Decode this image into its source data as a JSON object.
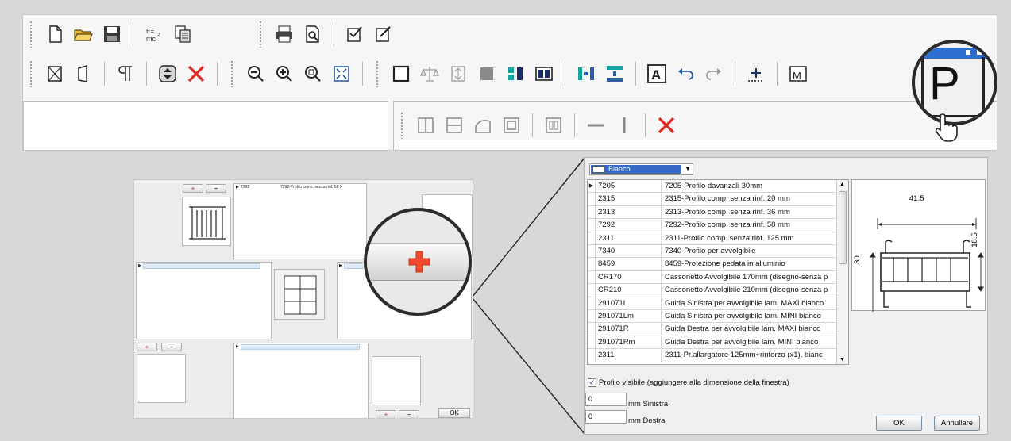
{
  "toolbar": {
    "row1_icons": [
      "new-file-icon",
      "open-folder-icon",
      "save-icon",
      "formula-icon",
      "copy-icon",
      "print-icon",
      "print-preview-icon",
      "edit-check-icon",
      "edit-check-2-icon"
    ],
    "row2_icons": [
      "frame-icon",
      "door-icon",
      "pilcrow-icon",
      "spin-icon",
      "delete-icon",
      "zoom-out-icon",
      "zoom-in-icon",
      "zoom-window-icon",
      "zoom-fit-icon",
      "select-rect-icon",
      "balance-icon",
      "align-icon",
      "gray-fill-icon",
      "columns-icon",
      "split-icon",
      "h-align-icon",
      "v-align-icon",
      "text-a-icon",
      "undo-icon",
      "redo-icon",
      "grid-plus-icon",
      "m-window-icon"
    ],
    "row3_icons": [
      "split-vertical-icon",
      "split-horizontal-icon",
      "arch-icon",
      "inner-rect-icon",
      "double-pane-icon",
      "minus-line-icon",
      "bar-line-icon",
      "close-x-icon"
    ],
    "magnifier_letter": "P"
  },
  "mini": {
    "plus": "+",
    "minus": "−",
    "row_code": "7292",
    "row_desc": "7292-Profilo comp. senza rinf. 58 X",
    "ok": "OK"
  },
  "dialog": {
    "color_selected": "Bianco",
    "rows": [
      {
        "code": "7205",
        "desc": "7205-Profilo davanzali 30mm"
      },
      {
        "code": "2315",
        "desc": "2315-Profilo comp. senza rinf. 20 mm"
      },
      {
        "code": "2313",
        "desc": "2313-Profilo comp. senza rinf. 36 mm"
      },
      {
        "code": "7292",
        "desc": "7292-Profilo comp. senza rinf. 58 mm"
      },
      {
        "code": "2311",
        "desc": "2311-Profilo comp. senza rinf. 125 mm"
      },
      {
        "code": "7340",
        "desc": "7340-Profilo per avvolgibile"
      },
      {
        "code": "8459",
        "desc": "8459-Protezione pedata in alluminio"
      },
      {
        "code": "CR170",
        "desc": "Cassonetto Avvolgibile 170mm (disegno-senza p"
      },
      {
        "code": "CR210",
        "desc": "Cassonetto Avvolgibile 210mm (disegno-senza p"
      },
      {
        "code": "291071L",
        "desc": "Guida Sinistra per avvolgibile lam. MAXI bianco"
      },
      {
        "code": "291071Lm",
        "desc": "Guida Sinistra per avvolgibile lam. MINI bianco"
      },
      {
        "code": "291071R",
        "desc": "Guida Destra per avvolgibile lam. MAXI bianco"
      },
      {
        "code": "291071Rm",
        "desc": "Guida Destra per avvolgibile lam. MINI bianco"
      },
      {
        "code": "2311",
        "desc": "2311-Pr.allargatore 125mm+rinforzo (x1), bianc"
      }
    ],
    "preview": {
      "dim_top": "41.5",
      "dim_left": "30",
      "dim_right": "18.5"
    },
    "checkbox_label": "Profilo visibile (aggiungere alla dimensione della finestra)",
    "left_value": "0",
    "left_label": "mm Sinistra:",
    "right_value": "0",
    "right_label": "mm Destra",
    "ok": "OK",
    "cancel": "Annullare"
  }
}
